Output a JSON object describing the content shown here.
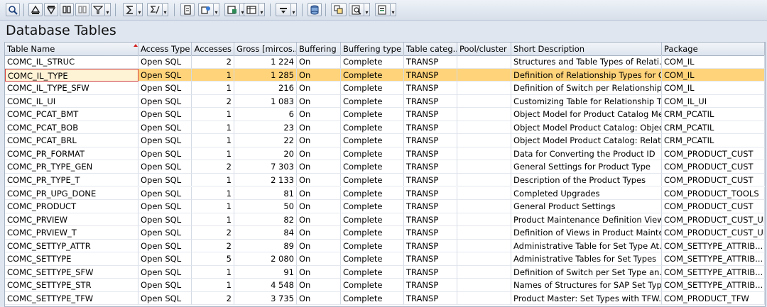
{
  "page_title": "Database Tables",
  "toolbar": {
    "buttons": [
      "details-icon",
      "select-first-icon",
      "filter-icon",
      "find-icon",
      "find-next-icon",
      "set-filter-icon",
      "sum-icon",
      "subtotal-icon",
      "print-preview-icon",
      "export-icon",
      "export-spreadsheet-icon",
      "layout-icon",
      "abc-analysis-icon",
      "graphic-icon",
      "word-processing-icon",
      "local-file-icon"
    ]
  },
  "table": {
    "columns": [
      "Table Name",
      "Access Type",
      "Accesses",
      "Gross [mircos...",
      "Buffering",
      "Buffering type",
      "Table categ...",
      "Pool/cluster",
      "Short Description",
      "Package"
    ],
    "rows": [
      [
        "COMC_IL_STRUC",
        "Open SQL",
        "2",
        "1 224",
        "On",
        "Complete",
        "TRANSP",
        "",
        "Structures and Table Types of Relati...",
        "COM_IL"
      ],
      [
        "COMC_IL_TYPE",
        "Open SQL",
        "1",
        "1 285",
        "On",
        "Complete",
        "TRANSP",
        "",
        "Definition of Relationship Types for O...",
        "COM_IL"
      ],
      [
        "COMC_IL_TYPE_SFW",
        "Open SQL",
        "1",
        "216",
        "On",
        "Complete",
        "TRANSP",
        "",
        "Definition of Switch per Relationship ...",
        "COM_IL"
      ],
      [
        "COMC_IL_UI",
        "Open SQL",
        "2",
        "1 083",
        "On",
        "Complete",
        "TRANSP",
        "",
        "Customizing Table for Relationship Ty...",
        "COM_IL_UI"
      ],
      [
        "COMC_PCAT_BMT",
        "Open SQL",
        "1",
        "6",
        "On",
        "Complete",
        "TRANSP",
        "",
        "Object Model for Product Catalog Me...",
        "CRM_PCATIL"
      ],
      [
        "COMC_PCAT_BOB",
        "Open SQL",
        "1",
        "23",
        "On",
        "Complete",
        "TRANSP",
        "",
        "Object Model Product Catalog: Objec...",
        "CRM_PCATIL"
      ],
      [
        "COMC_PCAT_BRL",
        "Open SQL",
        "1",
        "22",
        "On",
        "Complete",
        "TRANSP",
        "",
        "Object Model Product Catalog: Relati...",
        "CRM_PCATIL"
      ],
      [
        "COMC_PR_FORMAT",
        "Open SQL",
        "1",
        "20",
        "On",
        "Complete",
        "TRANSP",
        "",
        "Data for Converting the Product ID",
        "COM_PRODUCT_CUST"
      ],
      [
        "COMC_PR_TYPE_GEN",
        "Open SQL",
        "2",
        "7 303",
        "On",
        "Complete",
        "TRANSP",
        "",
        "General Settings for Product Type",
        "COM_PRODUCT_CUST"
      ],
      [
        "COMC_PR_TYPE_T",
        "Open SQL",
        "1",
        "2 133",
        "On",
        "Complete",
        "TRANSP",
        "",
        "Description of the Product Types",
        "COM_PRODUCT_CUST"
      ],
      [
        "COMC_PR_UPG_DONE",
        "Open SQL",
        "1",
        "81",
        "On",
        "Complete",
        "TRANSP",
        "",
        "Completed Upgrades",
        "COM_PRODUCT_TOOLS"
      ],
      [
        "COMC_PRODUCT",
        "Open SQL",
        "1",
        "50",
        "On",
        "Complete",
        "TRANSP",
        "",
        "General Product Settings",
        "COM_PRODUCT_CUST"
      ],
      [
        "COMC_PRVIEW",
        "Open SQL",
        "1",
        "82",
        "On",
        "Complete",
        "TRANSP",
        "",
        "Product Maintenance Definition Views",
        "COM_PRODUCT_CUST_UI"
      ],
      [
        "COMC_PRVIEW_T",
        "Open SQL",
        "2",
        "84",
        "On",
        "Complete",
        "TRANSP",
        "",
        "Definition of Views in Product Mainte...",
        "COM_PRODUCT_CUST_UI"
      ],
      [
        "COMC_SETTYP_ATTR",
        "Open SQL",
        "2",
        "89",
        "On",
        "Complete",
        "TRANSP",
        "",
        "Administrative Table for Set Type At...",
        "COM_SETTYPE_ATTRIB..."
      ],
      [
        "COMC_SETTYPE",
        "Open SQL",
        "5",
        "2 080",
        "On",
        "Complete",
        "TRANSP",
        "",
        "Administrative Tables for Set Types",
        "COM_SETTYPE_ATTRIB..."
      ],
      [
        "COMC_SETTYPE_SFW",
        "Open SQL",
        "1",
        "91",
        "On",
        "Complete",
        "TRANSP",
        "",
        "Definition of Switch per Set Type an...",
        "COM_SETTYPE_ATTRIB..."
      ],
      [
        "COMC_SETTYPE_STR",
        "Open SQL",
        "1",
        "4 548",
        "On",
        "Complete",
        "TRANSP",
        "",
        "Names of Structures for SAP Set Typ...",
        "COM_SETTYPE_ATTRIB..."
      ],
      [
        "COMC_SETTYPE_TFW",
        "Open SQL",
        "2",
        "3 735",
        "On",
        "Complete",
        "TRANSP",
        "",
        "Product Master: Set Types with TFW...",
        "COM_PRODUCT_TFW"
      ]
    ],
    "selected_row_index": 1
  }
}
